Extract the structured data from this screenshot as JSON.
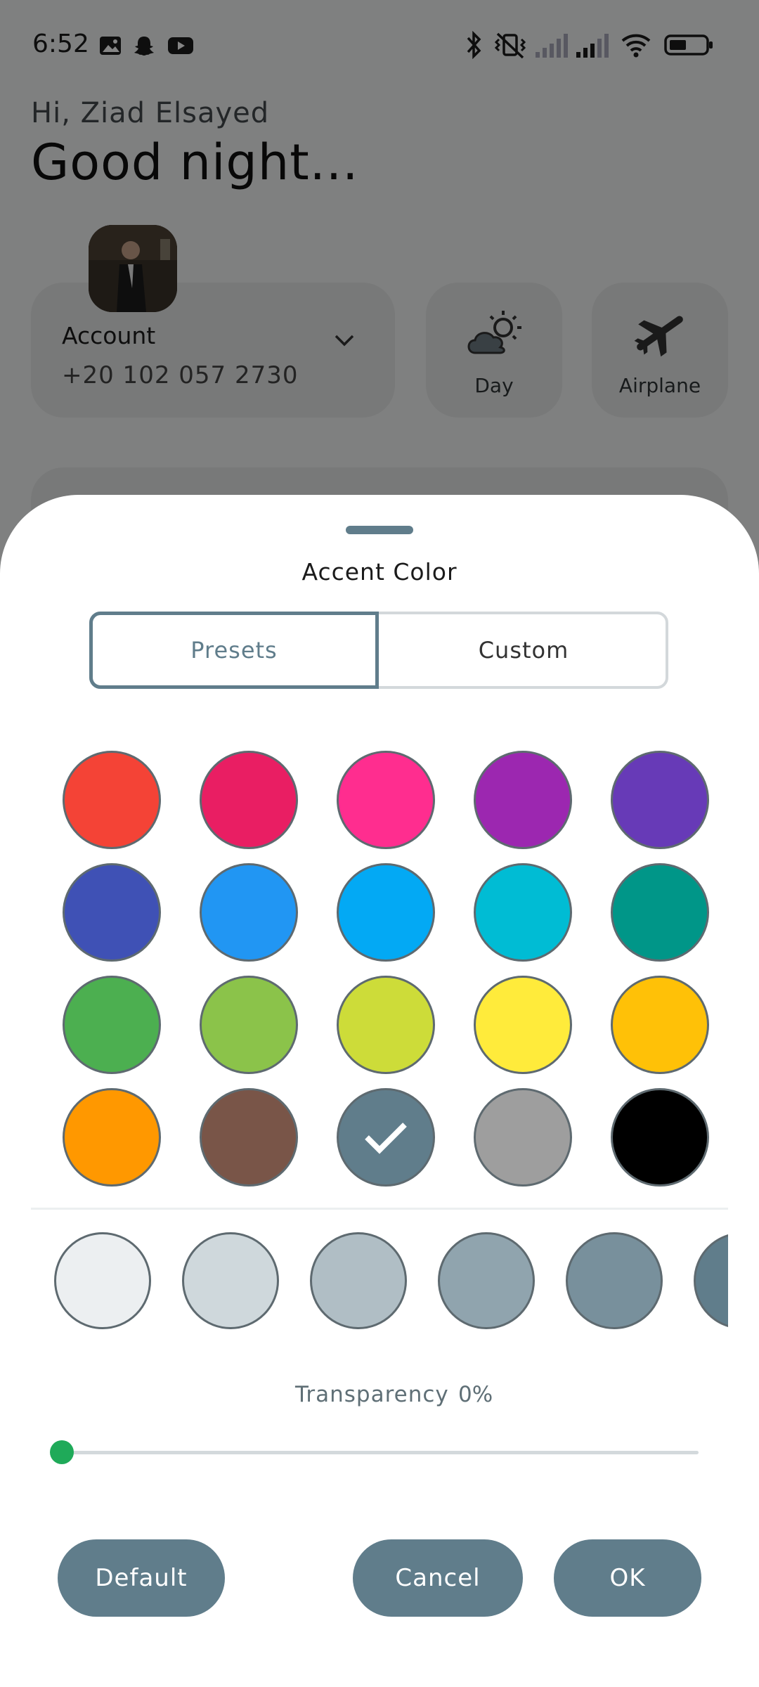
{
  "status_bar": {
    "time": "6:52",
    "notification_icons": [
      "gallery-icon",
      "snapchat-icon",
      "youtube-icon"
    ],
    "right_icons": [
      "bluetooth-icon",
      "vibrate-off-icon",
      "signal-icon",
      "signal-icon",
      "wifi-icon",
      "battery-icon"
    ],
    "battery_level": 0.45
  },
  "home": {
    "greeting": "Hi, Ziad Elsayed",
    "salutation": "Good night...",
    "account": {
      "label": "Account",
      "phone": "+20 102 057 2730"
    },
    "tiles": [
      {
        "label": "Day",
        "icon": "partly-cloudy-icon"
      },
      {
        "label": "Airplane",
        "icon": "airplane-icon"
      }
    ]
  },
  "sheet": {
    "title": "Accent Color",
    "tabs": [
      {
        "label": "Presets",
        "selected": true
      },
      {
        "label": "Custom",
        "selected": false
      }
    ],
    "presets": [
      "#f44336",
      "#e91e63",
      "#ff2d8f",
      "#9c27b0",
      "#673ab7",
      "#3f51b5",
      "#2196f3",
      "#03a9f4",
      "#00bcd4",
      "#009688",
      "#4caf50",
      "#8bc34a",
      "#cddc39",
      "#ffeb3b",
      "#ffc107",
      "#ff9800",
      "#795548",
      "#607d8b",
      "#9e9e9e",
      "#000000"
    ],
    "selected_preset_index": 17,
    "shades": [
      "#eceff1",
      "#cfd8dc",
      "#b0bec5",
      "#90a4ae",
      "#78909c",
      "#607d8b"
    ],
    "transparency": {
      "label": "Transparency",
      "value": "0%",
      "level": 0
    },
    "buttons": {
      "default": "Default",
      "cancel": "Cancel",
      "ok": "OK"
    },
    "accent_color": "#607d8b",
    "slider_color": "#1faa59"
  }
}
